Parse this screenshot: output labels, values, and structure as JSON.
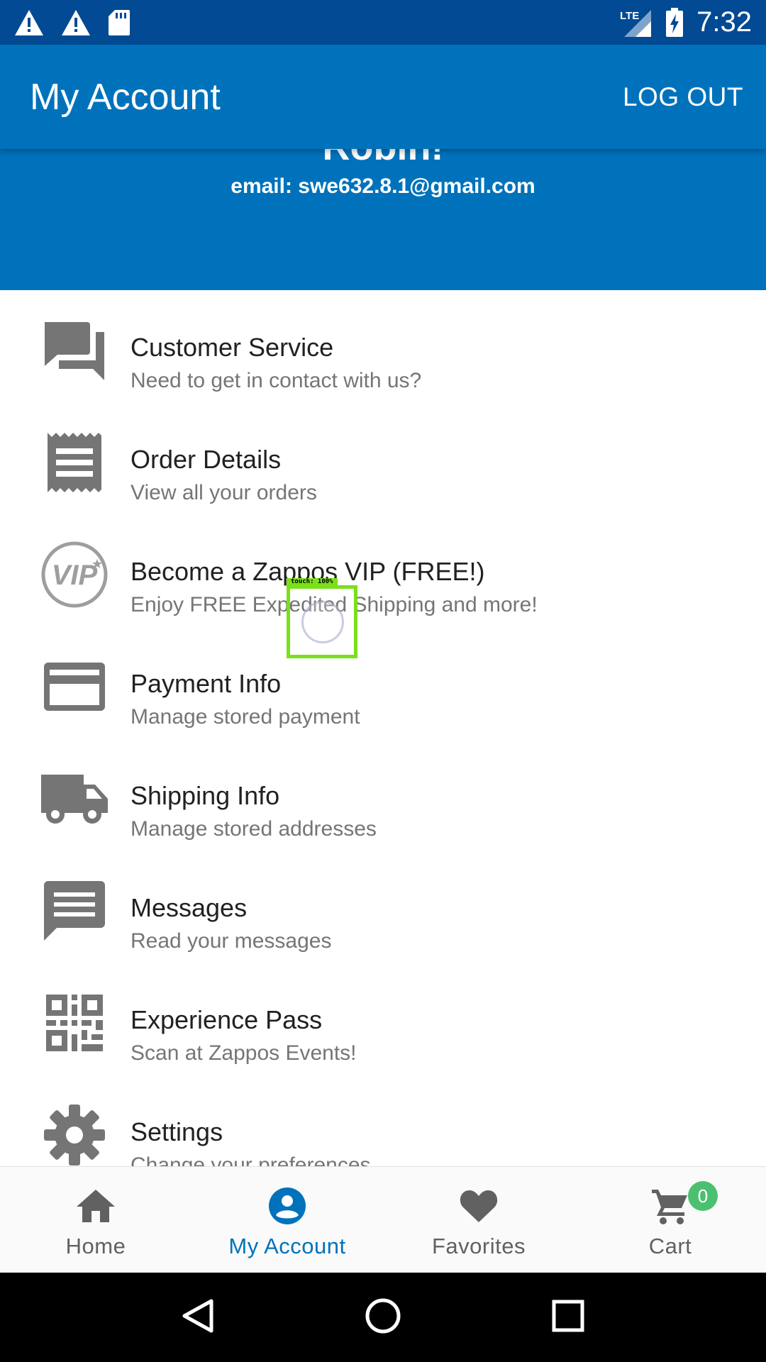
{
  "status_bar": {
    "time": "7:32",
    "left_icons": [
      "warning-icon",
      "warning-icon",
      "sd-card-icon"
    ],
    "right_icons": [
      "lte-signal-icon",
      "battery-charging-icon"
    ],
    "network_label": "LTE"
  },
  "app_bar": {
    "title": "My Account",
    "logout_label": "LOG OUT"
  },
  "profile": {
    "name_partial": "Robin!",
    "email": "email: swe632.8.1@gmail.com"
  },
  "menu": [
    {
      "icon": "forum-icon",
      "title": "Customer Service",
      "subtitle": "Need to get in contact with us?"
    },
    {
      "icon": "receipt-icon",
      "title": "Order Details",
      "subtitle": "View all your orders"
    },
    {
      "icon": "vip-icon",
      "title": "Become a Zappos VIP (FREE!)",
      "subtitle": "Enjoy FREE Expedited Shipping and more!"
    },
    {
      "icon": "credit-card-icon",
      "title": "Payment Info",
      "subtitle": "Manage stored payment"
    },
    {
      "icon": "truck-icon",
      "title": "Shipping Info",
      "subtitle": "Manage stored addresses"
    },
    {
      "icon": "message-icon",
      "title": "Messages",
      "subtitle": "Read your messages"
    },
    {
      "icon": "qr-code-icon",
      "title": "Experience Pass",
      "subtitle": "Scan at Zappos Events!"
    },
    {
      "icon": "gear-icon",
      "title": "Settings",
      "subtitle": "Change your preferences"
    }
  ],
  "bottom_nav": [
    {
      "icon": "home-icon",
      "label": "Home",
      "active": false
    },
    {
      "icon": "account-icon",
      "label": "My Account",
      "active": true
    },
    {
      "icon": "heart-icon",
      "label": "Favorites",
      "active": false
    },
    {
      "icon": "cart-icon",
      "label": "Cart",
      "active": false,
      "badge": "0"
    }
  ],
  "touch_indicator": {
    "label": "touch: 100%"
  },
  "colors": {
    "status_bar": "#024a93",
    "primary": "#0072bb",
    "icon_gray": "#757575",
    "badge": "#4cc071"
  }
}
